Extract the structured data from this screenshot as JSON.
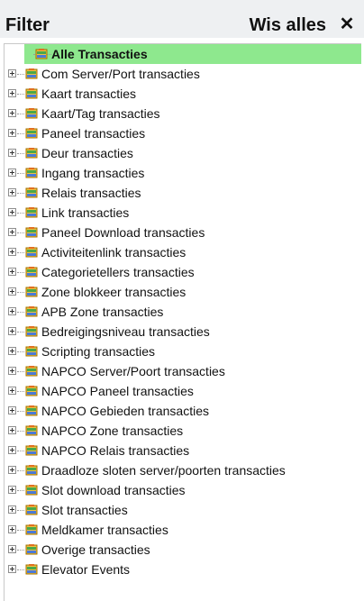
{
  "header": {
    "title": "Filter",
    "clear_label": "Wis alles",
    "close_label": "✕"
  },
  "tree": {
    "root": "Alle Transacties",
    "items": [
      "Com Server/Port transacties",
      "Kaart transacties",
      "Kaart/Tag transacties",
      "Paneel transacties",
      "Deur transacties",
      "Ingang transacties",
      "Relais transacties",
      "Link transacties",
      "Paneel Download transacties",
      "Activiteitenlink transacties",
      "Categorietellers transacties",
      "Zone blokkeer transacties",
      "APB Zone transacties",
      "Bedreigingsniveau transacties",
      "Scripting transacties",
      "NAPCO Server/Poort transacties",
      "NAPCO Paneel transacties",
      "NAPCO Gebieden transacties",
      "NAPCO Zone transacties",
      "NAPCO Relais transacties",
      "Draadloze sloten server/poorten transacties",
      "Slot download transacties",
      "Slot transacties",
      "Meldkamer transacties",
      "Overige transacties",
      "Elevator Events"
    ]
  },
  "colors": {
    "root_highlight": "#8ee88e",
    "header_bg": "#eef0f2"
  },
  "icons": {
    "tree_item": "transaction-folder-icon",
    "expand": "plus-expander-icon",
    "close": "close-icon"
  }
}
